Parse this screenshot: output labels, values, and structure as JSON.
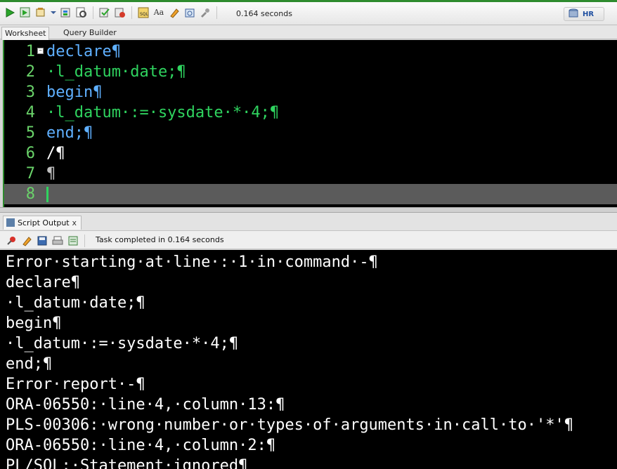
{
  "toolbar": {
    "icons": [
      "run-statement-icon",
      "run-script-icon",
      "commit-icon",
      "rollback-icon",
      "explain-plan-icon",
      "autotrace-icon",
      "sql-tuning-icon",
      "format-icon",
      "clear-icon",
      "history-icon",
      "tools-icon"
    ],
    "timing": "0.164 seconds",
    "connection": "HR"
  },
  "tabs": [
    {
      "label": "Worksheet",
      "active": true
    },
    {
      "label": "Query Builder",
      "active": false
    }
  ],
  "editor": {
    "lines": [
      {
        "num": "1",
        "code": "declare¶"
      },
      {
        "num": "2",
        "code": "·l_datum·date;¶"
      },
      {
        "num": "3",
        "code": "begin¶"
      },
      {
        "num": "4",
        "code": "·l_datum·:=·sysdate·*·4;¶"
      },
      {
        "num": "5",
        "code": "end;¶"
      },
      {
        "num": "6",
        "code": "/¶"
      },
      {
        "num": "7",
        "code": "¶"
      },
      {
        "num": "8",
        "code": ""
      }
    ]
  },
  "output_panel": {
    "tab_label": "Script Output",
    "close_label": "x",
    "task_text": "Task completed in 0.164 seconds",
    "lines": [
      "Error·starting·at·line·:·1·in·command·-¶",
      "declare¶",
      "·l_datum·date;¶",
      "begin¶",
      "·l_datum·:=·sysdate·*·4;¶",
      "end;¶",
      "Error·report·-¶",
      "ORA-06550:·line·4,·column·13:¶",
      "PLS-00306:·wrong·number·or·types·of·arguments·in·call·to·'*'¶",
      "ORA-06550:·line·4,·column·2:¶",
      "PL/SQL:·Statement·ignored¶"
    ]
  },
  "colors": {
    "keyword": "#5fb0ff",
    "identifier": "#2fd35f",
    "line_number": "#6ad36a",
    "editor_bg": "#000000"
  }
}
